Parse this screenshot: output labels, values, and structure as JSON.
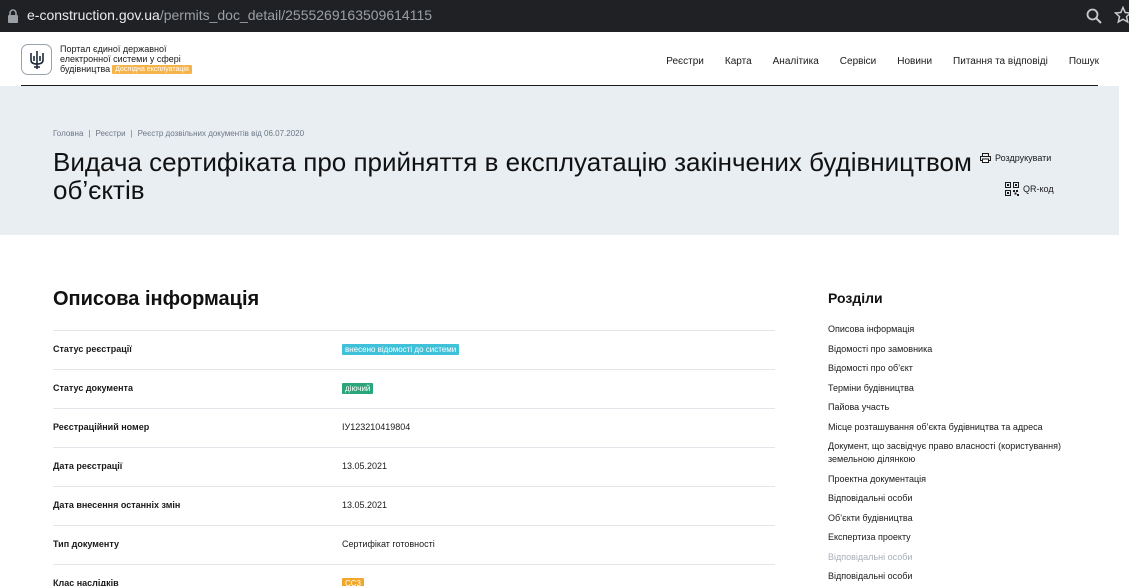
{
  "browser": {
    "url_host": "e-construction.gov.ua",
    "url_path": "/permits_doc_detail/2555269163509614115"
  },
  "header": {
    "logo_line1": "Портал єдиної державної",
    "logo_line2": "електронної системи у сфері",
    "logo_line3": "будівництва",
    "beta_badge": "Дослідна експлуатація",
    "nav": [
      "Реєстри",
      "Карта",
      "Аналітика",
      "Сервіси",
      "Новини",
      "Питання та відповіді",
      "Пошук"
    ]
  },
  "hero": {
    "breadcrumb": [
      "Головна",
      "Реєстри",
      "Реєстр дозвільних документів від 06.07.2020"
    ],
    "title": "Видача сертифіката про прийняття в експлуатацію закінчених будівництвом об’єктів",
    "print_label": "Роздрукувати",
    "qr_label": "QR-код"
  },
  "main": {
    "section_title": "Описова інформація",
    "rows": [
      {
        "label": "Статус реєстрації",
        "value": "внесено відомості до системи",
        "tag": "blue"
      },
      {
        "label": "Статус документа",
        "value": "діючий",
        "tag": "green"
      },
      {
        "label": "Реєстраційний номер",
        "value": "ІУ123210419804"
      },
      {
        "label": "Дата реєстрації",
        "value": "13.05.2021"
      },
      {
        "label": "Дата внесення останніх змін",
        "value": "13.05.2021"
      },
      {
        "label": "Тип документу",
        "value": "Сертифікат готовності"
      },
      {
        "label": "Клас наслідків",
        "value": "СС3",
        "tag": "orange"
      }
    ]
  },
  "toc": {
    "title": "Розділи",
    "items": [
      {
        "label": "Описова інформація"
      },
      {
        "label": "Відомості про замовника"
      },
      {
        "label": "Відомості про об’єкт"
      },
      {
        "label": "Терміни будівництва"
      },
      {
        "label": "Пайова участь"
      },
      {
        "label": "Місце розташування об’єкта будівництва та адреса"
      },
      {
        "label": "Документ, що засвідчує право власності (користування) земельною ділянкою"
      },
      {
        "label": "Проектна документація"
      },
      {
        "label": "Відповідальні особи"
      },
      {
        "label": "Об’єкти будівництва"
      },
      {
        "label": "Експертиза проекту"
      },
      {
        "label": "Відповідальні особи",
        "muted": true
      },
      {
        "label": "Відповідальні особи"
      }
    ]
  },
  "colors": {
    "hero_bg": "#e9eef3",
    "tag_blue": "#3fc1d9",
    "tag_green": "#2ba57a",
    "tag_orange": "#f1a72c",
    "badge": "#f5b34c"
  }
}
